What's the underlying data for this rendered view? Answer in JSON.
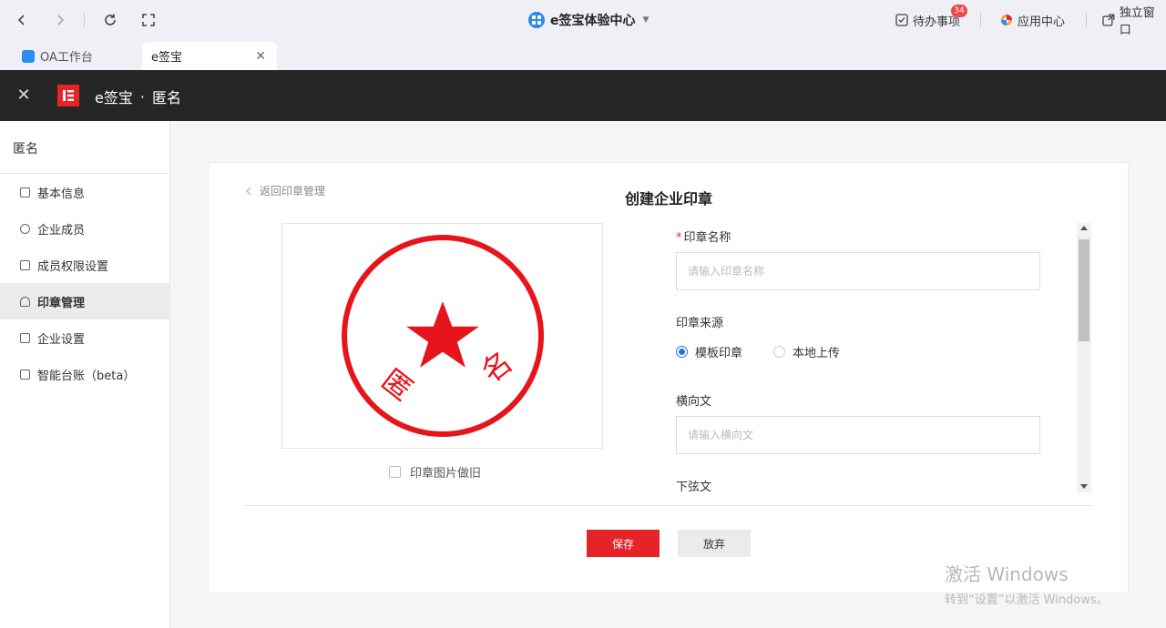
{
  "browser": {
    "center_title": "e签宝体验中心",
    "todo_label": "待办事项",
    "todo_badge": "34",
    "app_center_label": "应用中心",
    "standalone_label": "独立窗口"
  },
  "tabs": [
    {
      "label": "OA工作台",
      "active": false
    },
    {
      "label": "e签宝",
      "active": true
    }
  ],
  "header": {
    "app_name": "e签宝",
    "separator": "·",
    "org_name": "匿名"
  },
  "sidebar": {
    "title": "匿名",
    "items": [
      {
        "label": "基本信息",
        "icon": "document-icon",
        "active": false
      },
      {
        "label": "企业成员",
        "icon": "members-icon",
        "active": false
      },
      {
        "label": "成员权限设置",
        "icon": "permission-icon",
        "active": false
      },
      {
        "label": "印章管理",
        "icon": "seal-icon",
        "active": true
      },
      {
        "label": "企业设置",
        "icon": "settings-icon",
        "active": false
      },
      {
        "label": "智能台账（beta）",
        "icon": "ledger-icon",
        "active": false
      }
    ]
  },
  "main": {
    "back_label": "返回印章管理",
    "form_title": "创建企业印章",
    "seal_text": "匿名",
    "seal_color": "#e8141b",
    "aging_label": "印章图片做旧",
    "fields": {
      "seal_name_label": "印章名称",
      "seal_name_placeholder": "请输入印章名称",
      "source_label": "印章来源",
      "source_options": [
        "模板印章",
        "本地上传"
      ],
      "source_selected": "模板印章",
      "horizontal_label": "横向文",
      "horizontal_placeholder": "请输入横向文",
      "chord_label": "下弦文"
    },
    "save_label": "保存",
    "discard_label": "放弃"
  },
  "watermark": {
    "line1": "激活 Windows",
    "line2": "转到“设置”以激活 Windows。"
  },
  "colors": {
    "accent_red": "#e5242a",
    "radio_blue": "#2d6cf0",
    "header_dark": "#262626"
  }
}
